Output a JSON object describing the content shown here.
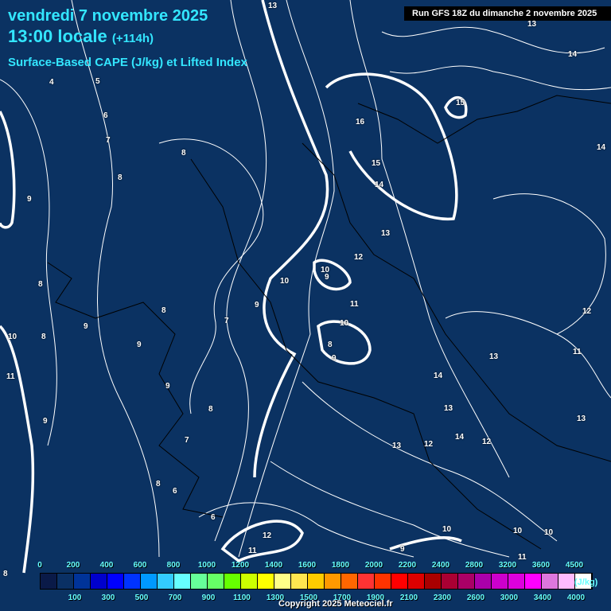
{
  "header": {
    "date": "vendredi 7 novembre 2025",
    "time": "13:00 locale",
    "lead": "(+114h)",
    "product": "Surface-Based CAPE (J/kg) et Lifted Index",
    "run": "Run GFS 18Z du dimanche 2 novembre 2025"
  },
  "legend": {
    "top_ticks": [
      "0",
      "200",
      "400",
      "600",
      "800",
      "1000",
      "1200",
      "1400",
      "1600",
      "1800",
      "2000",
      "2200",
      "2400",
      "2800",
      "3200",
      "3600",
      "4500"
    ],
    "bottom_ticks": [
      "100",
      "300",
      "500",
      "700",
      "900",
      "1100",
      "1300",
      "1500",
      "1700",
      "1900",
      "2100",
      "2300",
      "2600",
      "3000",
      "3400",
      "4000"
    ],
    "unit": "(J/kg)",
    "colors": [
      "#0a1a48",
      "#0a3064",
      "#003399",
      "#0000cc",
      "#0000ff",
      "#0033ff",
      "#0099ff",
      "#33ccff",
      "#66ffff",
      "#66ff99",
      "#66ff66",
      "#66ff00",
      "#ccff00",
      "#ffff00",
      "#ffff88",
      "#ffe650",
      "#ffcc00",
      "#ff9900",
      "#ff6600",
      "#ff3333",
      "#ff3300",
      "#ff0000",
      "#dd0000",
      "#aa0000",
      "#aa0033",
      "#aa0066",
      "#aa00aa",
      "#cc00cc",
      "#dd00dd",
      "#ff00ff",
      "#dd77dd",
      "#ffbbff",
      "#ffffff"
    ]
  },
  "copyright": "Copyright 2025 Meteociel.fr",
  "contour_labels": [
    "13",
    "13",
    "14",
    "15",
    "16",
    "15",
    "14",
    "14",
    "13",
    "12",
    "10",
    "9",
    "10",
    "11",
    "10",
    "8",
    "9",
    "12",
    "13",
    "14",
    "13",
    "14",
    "12",
    "13",
    "12",
    "11",
    "13",
    "4",
    "5",
    "6",
    "7",
    "8",
    "8",
    "9",
    "8",
    "9",
    "7",
    "8",
    "9",
    "9",
    "8",
    "9",
    "10",
    "11",
    "9",
    "8",
    "7",
    "8",
    "6",
    "6",
    "12",
    "11",
    "10",
    "10",
    "10",
    "11",
    "9",
    "8"
  ],
  "background_color": "#0b3262"
}
